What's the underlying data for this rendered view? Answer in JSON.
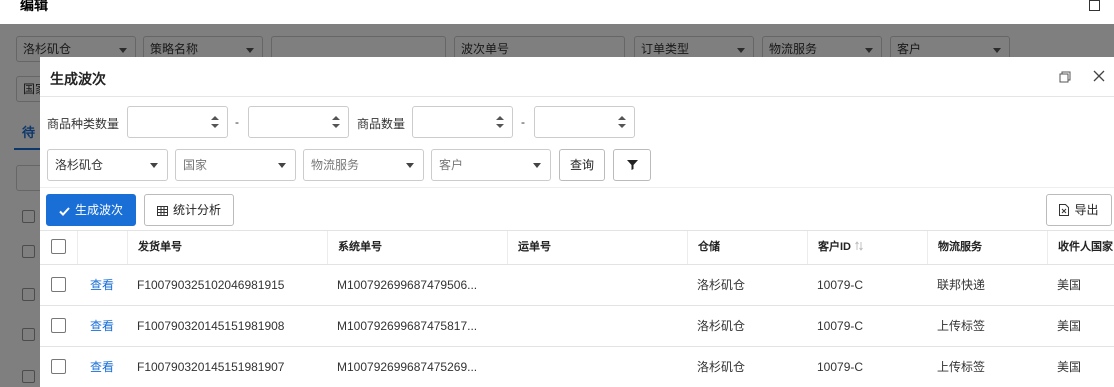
{
  "background": {
    "title": "编辑",
    "filters": [
      "洛杉矶仓",
      "策略名称",
      "",
      "波次单号",
      "订单类型",
      "物流服务",
      "客户"
    ],
    "row2_label": "国家",
    "tab_label": "待"
  },
  "modal": {
    "title": "生成波次",
    "filters": {
      "sku_kind_label": "商品种类数量",
      "qty_label": "商品数量",
      "dash": "-",
      "warehouse": "洛杉矶仓",
      "country_placeholder": "国家",
      "logistics_placeholder": "物流服务",
      "customer_placeholder": "客户",
      "query_label": "查询"
    },
    "toolbar": {
      "generate_label": "生成波次",
      "stats_label": "统计分析",
      "export_label": "导出"
    },
    "table": {
      "columns": [
        "",
        "",
        "发货单号",
        "系统单号",
        "运单号",
        "仓储",
        "客户ID",
        "物流服务",
        "收件人国家"
      ],
      "view_label": "查看",
      "rows": [
        {
          "ship_no": "F100790325102046981915",
          "sys_no": "M100792699687479506...",
          "waybill": "",
          "warehouse": "洛杉矶仓",
          "customer_id": "10079-C",
          "logistics": "联邦快递",
          "country": "美国"
        },
        {
          "ship_no": "F100790320145151981908",
          "sys_no": "M100792699687475817...",
          "waybill": "",
          "warehouse": "洛杉矶仓",
          "customer_id": "10079-C",
          "logistics": "上传标签",
          "country": "美国"
        },
        {
          "ship_no": "F100790320145151981907",
          "sys_no": "M100792699687475269...",
          "waybill": "",
          "warehouse": "洛杉矶仓",
          "customer_id": "10079-C",
          "logistics": "上传标签",
          "country": "美国"
        }
      ]
    }
  },
  "colors": {
    "primary": "#1a6fd6",
    "link": "#1a6fd6",
    "overlay": "rgba(0,0,0,0.5)"
  },
  "icons": [
    "maximize-icon",
    "restore-window-icon",
    "close-icon",
    "spinner-arrows-icon",
    "chevron-down-icon",
    "filter-icon",
    "check-icon",
    "grid-table-icon",
    "export-file-icon",
    "sort-icon"
  ]
}
